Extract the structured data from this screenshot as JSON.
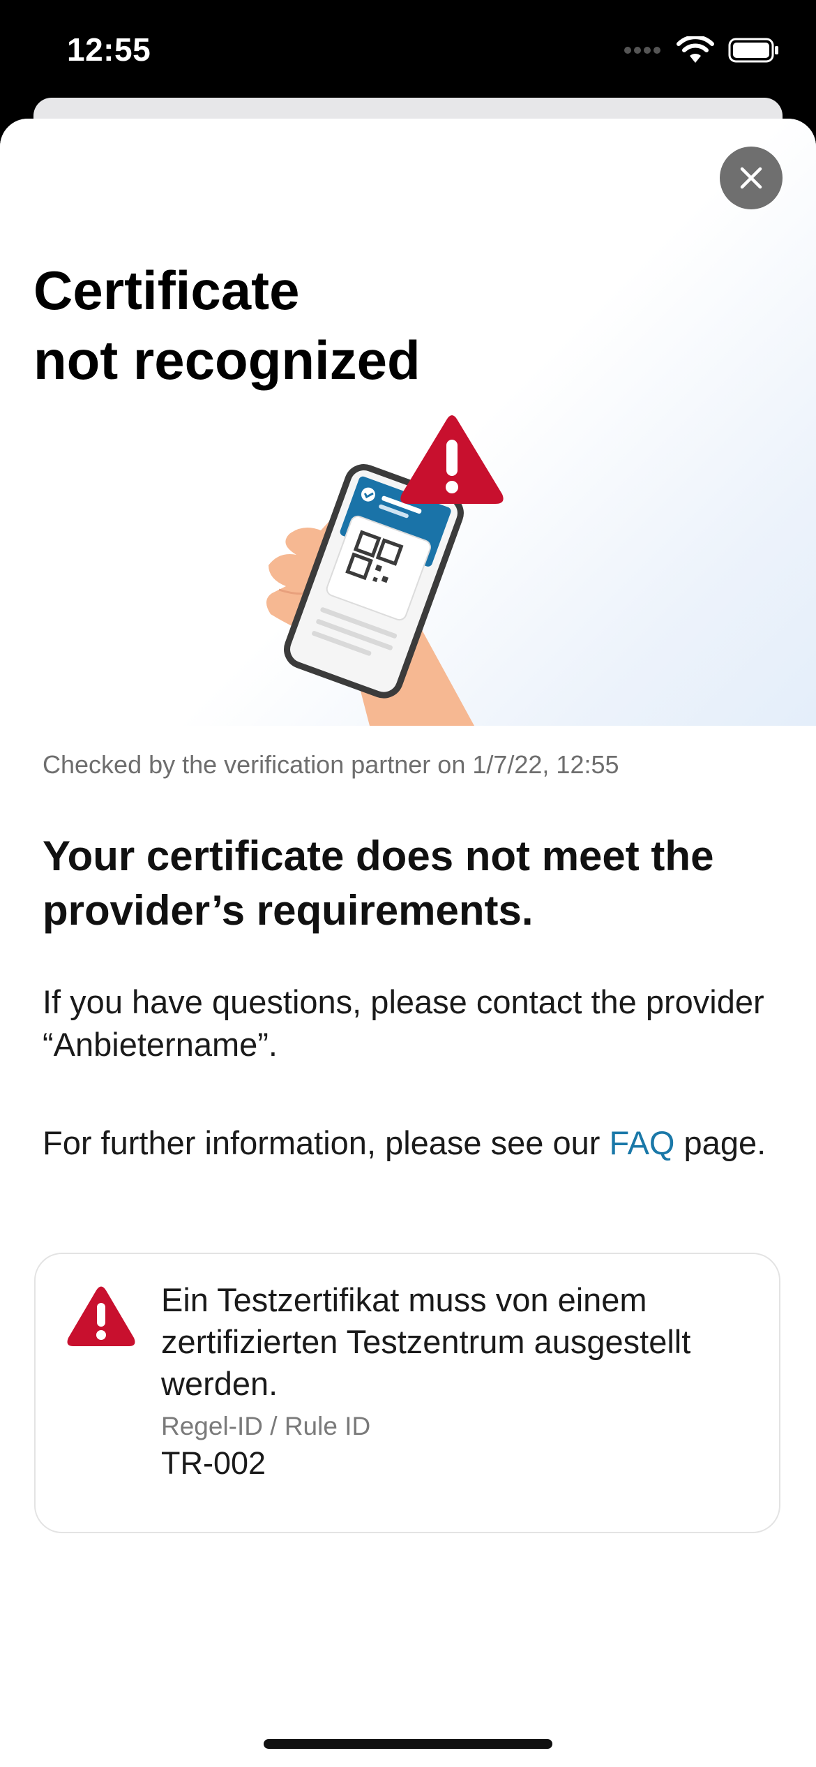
{
  "status_bar": {
    "time": "12:55"
  },
  "sheet": {
    "title_line1": "Certificate",
    "title_line2": "not recognized",
    "checked_text": "Checked by the verification partner on 1/7/22, 12:55",
    "headline": "Your certificate does not meet the provider’s requirements.",
    "contact_text": "If you have questions, please contact the provider “Anbietername”.",
    "faq_prefix": "For further information, please see our ",
    "faq_link": "FAQ",
    "faq_suffix": " page.",
    "rule_card": {
      "message": "Ein Testzertifikat muss von einem zertifizierten Testzentrum ausgestellt werden.",
      "rule_label": "Regel-ID / Rule ID",
      "rule_id": "TR-002"
    }
  },
  "colors": {
    "warning_red": "#c8102e",
    "link_blue": "#1a78a8",
    "close_button": "#6f6f6f",
    "phone_screen_blue": "#1a73a8",
    "skin": "#f6b892"
  },
  "icons": [
    "wifi-icon",
    "battery-icon",
    "signal-icon",
    "close-icon",
    "warning-icon",
    "phone-qr-illustration"
  ]
}
